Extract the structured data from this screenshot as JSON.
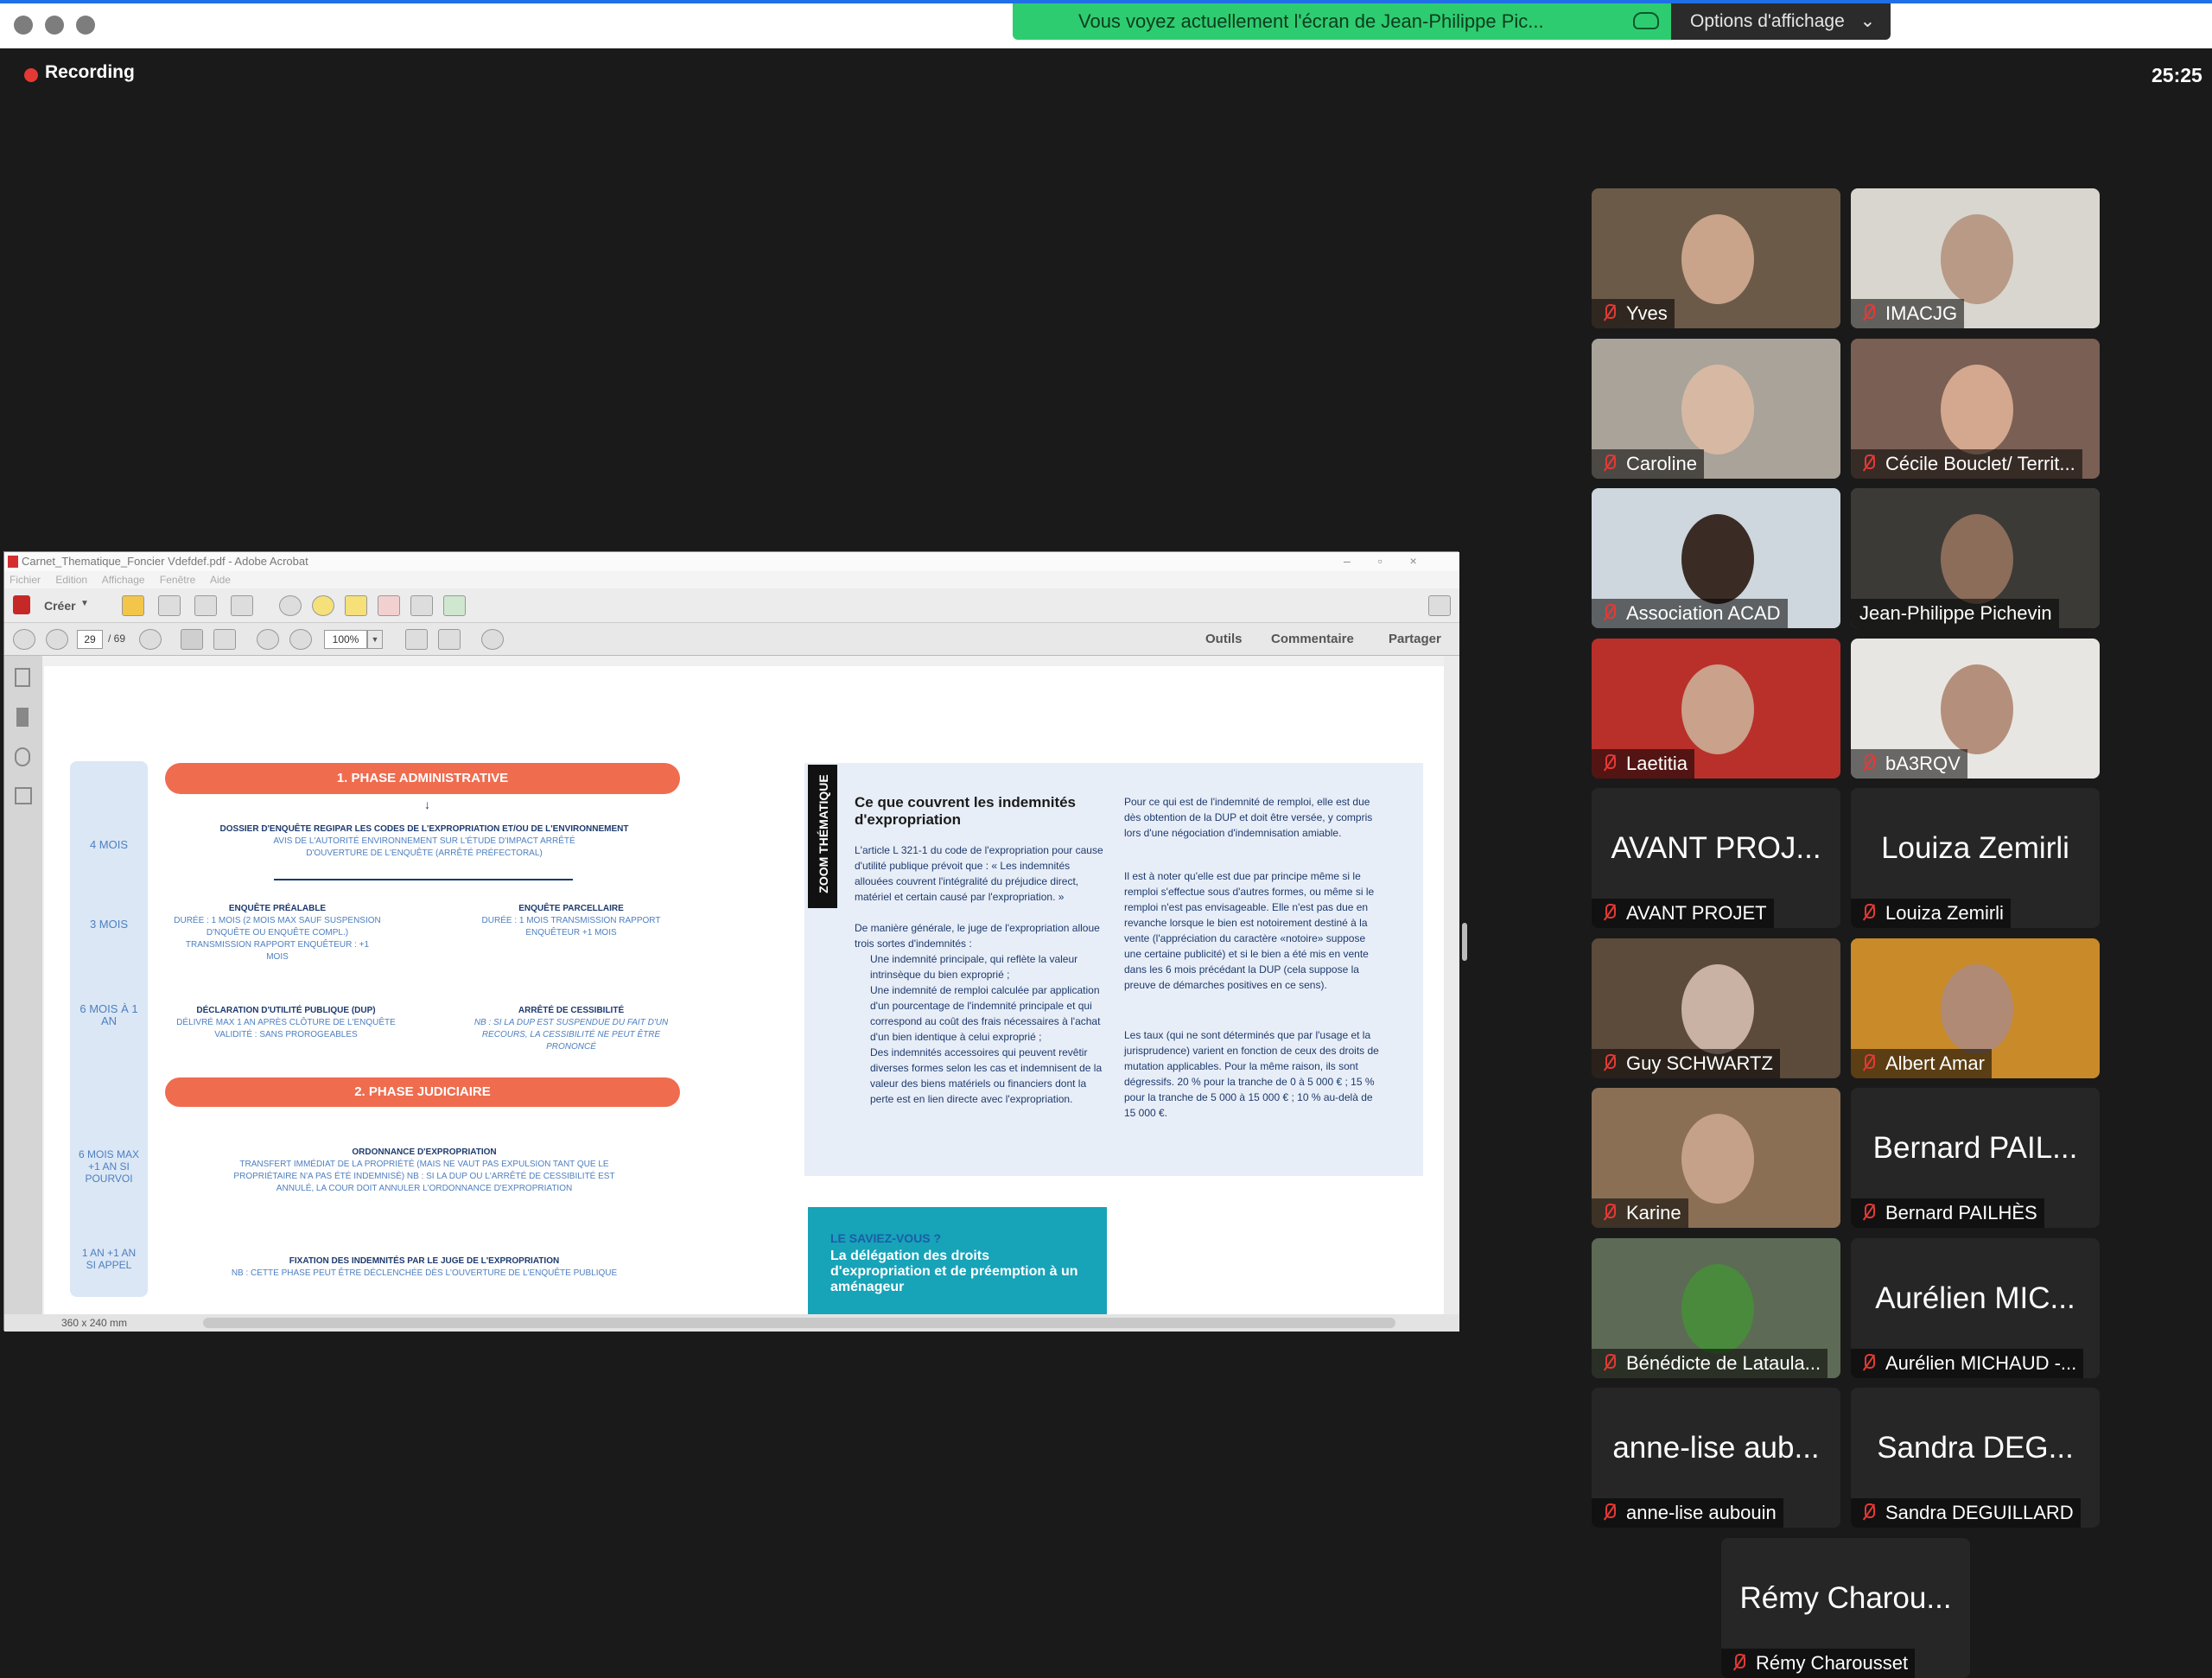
{
  "topbar": {
    "share_banner": "Vous voyez actuellement l'écran de Jean-Philippe Pic...",
    "options_label": "Options d'affichage",
    "options_chevron": "⌄"
  },
  "recording": {
    "label": "Recording"
  },
  "timer": "25:25",
  "acrobat": {
    "title": "Carnet_Thematique_Foncier Vdefdef.pdf - Adobe Acrobat",
    "menu": [
      "Fichier",
      "Edition",
      "Affichage",
      "Fenêtre",
      "Aide"
    ],
    "create_label": "Créer",
    "page_current": "29",
    "page_total": "/ 69",
    "zoom": "100%",
    "tabs": [
      "Outils",
      "Commentaire",
      "Partager"
    ],
    "status": "360 x 240 mm",
    "doc": {
      "phase1": "1. PHASE ADMINISTRATIVE",
      "phase2": "2. PHASE JUDICIAIRE",
      "durations": [
        "4 MOIS",
        "3 MOIS",
        "6 MOIS À 1 AN",
        "6 MOIS MAX +1 AN SI POURVOI",
        "1 AN +1 AN SI APPEL"
      ],
      "dossier_title": "DOSSIER D'ENQUÊTE REGIPAR LES CODES DE L'EXPROPRIATION ET/OU DE L'ENVIRONNEMENT",
      "dossier_sub": "AVIS DE L'AUTORITÉ ENVIRONNEMENT SUR L'ÉTUDE D'IMPACT ARRÊTÉ D'OUVERTURE DE L'ENQUÊTE (ARRÊTÉ PRÉFECTORAL)",
      "enq_prealable": "ENQUÊTE PRÉALABLE",
      "enq_prealable_sub": "DURÉE : 1 MOIS (2 MOIS MAX SAUF SUSPENSION D'NQUÊTE OU ENQUÊTE COMPL.) TRANSMISSION RAPPORT ENQUÊTEUR : +1 MOIS",
      "enq_parcellaire": "ENQUÊTE PARCELLAIRE",
      "enq_parcellaire_sub": "DURÉE : 1 MOIS TRANSMISSION RAPPORT ENQUÊTEUR +1 MOIS",
      "dup": "DÉCLARATION D'UTILITÉ PUBLIQUE (DUP)",
      "dup_sub": "DÉLIVRÉ MAX 1 AN APRÈS CLÔTURE DE L'ENQUÊTE VALIDITÉ : SANS PROROGEABLES",
      "cess": "ARRÊTÉ DE CESSIBILITÉ",
      "cess_sub": "NB : SI LA DUP EST SUSPENDUE DU FAIT D'UN RECOURS, LA CESSIBILITÉ NE PEUT ÊTRE PRONONCÉ",
      "ordo": "ORDONNANCE D'EXPROPRIATION",
      "ordo_sub": "TRANSFERT IMMÉDIAT DE LA PROPRIÉTÉ (MAIS NE VAUT PAS EXPULSION TANT QUE LE PROPRIÉTAIRE N'A PAS ÉTÉ INDEMNISÉ) NB : SI LA DUP OU L'ARRÊTÉ DE CESSIBILITÉ EST ANNULÉ, LA COUR DOIT ANNULER L'ORDONNANCE D'EXPROPRIATION",
      "fix": "FIXATION DES INDEMNITÉS PAR LE JUGE DE L'EXPROPRIATION",
      "fix_sub": "NB : CETTE PHASE PEUT ÊTRE DÉCLENCHÉE DÈS L'OUVERTURE DE L'ENQUÊTE PUBLIQUE",
      "zoom_tag": "ZOOM THÉMATIQUE",
      "zoom_title": "Ce que couvrent les indemnités d'expropriation",
      "zoom_p1": "L'article L 321-1 du code de l'expropriation pour cause d'utilité publique prévoit que : « Les indemnités allouées couvrent l'intégralité du préjudice direct, matériel et certain causé par l'expropriation. »",
      "zoom_p2": "De manière générale, le juge de l'expropriation alloue trois sortes d'indemnités :",
      "zoom_b1": "Une indemnité principale, qui reflète la valeur intrinsèque du bien exproprié ;",
      "zoom_b2": "Une indemnité de remploi calculée par application d'un pourcentage de l'indemnité principale et qui correspond au coût des frais nécessaires à l'achat d'un bien identique à celui exproprié ;",
      "zoom_b3": "Des indemnités accessoires qui peuvent revêtir diverses formes selon les cas et indemnisent de la valeur des biens matériels ou financiers dont la perte est en lien directe avec l'expropriation.",
      "zoom_c1": "Pour ce qui est de l'indemnité de remploi, elle est due dès obtention de la DUP et doit être versée, y compris lors d'une négociation d'indemnisation amiable.",
      "zoom_c2": "Il est à noter qu'elle est due par principe même si le remploi s'effectue sous d'autres formes, ou même si le remploi n'est pas envisageable. Elle n'est pas due en revanche lorsque le bien est notoirement destiné à la vente (l'appréciation du caractère «notoire» suppose une certaine publicité) et si le bien a été mis en vente dans les 6 mois précédant la DUP (cela suppose la preuve de démarches positives en ce sens).",
      "zoom_c3": "Les taux (qui ne sont déterminés que par l'usage et la jurisprudence) varient en fonction de ceux des droits de mutation applicables. Pour la même raison, ils sont dégressifs. 20 % pour la tranche de 0 à 5 000 € ; 15 % pour la tranche de 5 000 à 15 000 € ; 10 % au-delà de 15 000 €.",
      "saviez_kicker": "LE SAVIEZ-VOUS ?",
      "saviez_title": "La délégation des droits d'expropriation et de préemption à un aménageur"
    }
  },
  "participants": [
    {
      "name": "Yves",
      "label": "",
      "video": true,
      "bg": "#6b5a48",
      "face": "#c9a48a"
    },
    {
      "name": "IMACJG",
      "label": "",
      "video": true,
      "bg": "#d9d6cf",
      "face": "#b89a86"
    },
    {
      "name": "Caroline",
      "label": "",
      "video": true,
      "bg": "#a9a39a",
      "face": "#d7b9a3"
    },
    {
      "name": "Cécile Bouclet/ Territ...",
      "label": "",
      "video": true,
      "bg": "#7a5f54",
      "face": "#d4a78f"
    },
    {
      "name": "Association ACAD",
      "label": "",
      "video": true,
      "bg": "#cfd7de",
      "face": "#3a2c25"
    },
    {
      "name": "Jean-Philippe Pichevin",
      "label": "",
      "video": true,
      "bg": "#3b3a37",
      "face": "#8c6d5a",
      "active": true
    },
    {
      "name": "Laetitia",
      "label": "",
      "video": true,
      "bg": "#b9302b",
      "face": "#caa18b"
    },
    {
      "name": "bA3RQV",
      "label": "",
      "video": true,
      "bg": "#e8e6e2",
      "face": "#b48f7b"
    },
    {
      "name": "AVANT PROJET",
      "label": "AVANT PROJ...",
      "video": false
    },
    {
      "name": "Louiza Zemirli",
      "label": "Louiza Zemirli",
      "video": false
    },
    {
      "name": "Guy SCHWARTZ",
      "label": "",
      "video": true,
      "bg": "#5c4a3b",
      "face": "#c9b2a3"
    },
    {
      "name": "Albert Amar",
      "label": "",
      "video": true,
      "bg": "#c98a2a",
      "face": "#b08a74"
    },
    {
      "name": "Karine",
      "label": "",
      "video": true,
      "bg": "#8a6f55",
      "face": "#c5a18a"
    },
    {
      "name": "Bernard PAILHÈS",
      "label": "Bernard PAIL...",
      "video": false
    },
    {
      "name": "Bénédicte de Lataula...",
      "label": "",
      "video": true,
      "bg": "#5d6a55",
      "face": "#4a8a3c"
    },
    {
      "name": "Aurélien MICHAUD -...",
      "label": "Aurélien MIC...",
      "video": false
    },
    {
      "name": "anne-lise aubouin",
      "label": "anne-lise aub...",
      "video": false
    },
    {
      "name": "Sandra DEGUILLARD",
      "label": "Sandra DEG...",
      "video": false
    },
    {
      "name": "Rémy Charousset",
      "label": "Rémy Charou...",
      "video": false
    }
  ]
}
